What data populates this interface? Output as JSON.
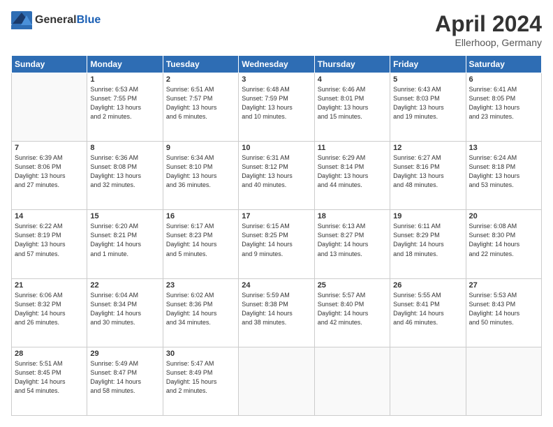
{
  "header": {
    "logo_general": "General",
    "logo_blue": "Blue",
    "month": "April 2024",
    "location": "Ellerhoop, Germany"
  },
  "weekdays": [
    "Sunday",
    "Monday",
    "Tuesday",
    "Wednesday",
    "Thursday",
    "Friday",
    "Saturday"
  ],
  "weeks": [
    [
      {
        "day": "",
        "info": ""
      },
      {
        "day": "1",
        "info": "Sunrise: 6:53 AM\nSunset: 7:55 PM\nDaylight: 13 hours\nand 2 minutes."
      },
      {
        "day": "2",
        "info": "Sunrise: 6:51 AM\nSunset: 7:57 PM\nDaylight: 13 hours\nand 6 minutes."
      },
      {
        "day": "3",
        "info": "Sunrise: 6:48 AM\nSunset: 7:59 PM\nDaylight: 13 hours\nand 10 minutes."
      },
      {
        "day": "4",
        "info": "Sunrise: 6:46 AM\nSunset: 8:01 PM\nDaylight: 13 hours\nand 15 minutes."
      },
      {
        "day": "5",
        "info": "Sunrise: 6:43 AM\nSunset: 8:03 PM\nDaylight: 13 hours\nand 19 minutes."
      },
      {
        "day": "6",
        "info": "Sunrise: 6:41 AM\nSunset: 8:05 PM\nDaylight: 13 hours\nand 23 minutes."
      }
    ],
    [
      {
        "day": "7",
        "info": "Sunrise: 6:39 AM\nSunset: 8:06 PM\nDaylight: 13 hours\nand 27 minutes."
      },
      {
        "day": "8",
        "info": "Sunrise: 6:36 AM\nSunset: 8:08 PM\nDaylight: 13 hours\nand 32 minutes."
      },
      {
        "day": "9",
        "info": "Sunrise: 6:34 AM\nSunset: 8:10 PM\nDaylight: 13 hours\nand 36 minutes."
      },
      {
        "day": "10",
        "info": "Sunrise: 6:31 AM\nSunset: 8:12 PM\nDaylight: 13 hours\nand 40 minutes."
      },
      {
        "day": "11",
        "info": "Sunrise: 6:29 AM\nSunset: 8:14 PM\nDaylight: 13 hours\nand 44 minutes."
      },
      {
        "day": "12",
        "info": "Sunrise: 6:27 AM\nSunset: 8:16 PM\nDaylight: 13 hours\nand 48 minutes."
      },
      {
        "day": "13",
        "info": "Sunrise: 6:24 AM\nSunset: 8:18 PM\nDaylight: 13 hours\nand 53 minutes."
      }
    ],
    [
      {
        "day": "14",
        "info": "Sunrise: 6:22 AM\nSunset: 8:19 PM\nDaylight: 13 hours\nand 57 minutes."
      },
      {
        "day": "15",
        "info": "Sunrise: 6:20 AM\nSunset: 8:21 PM\nDaylight: 14 hours\nand 1 minute."
      },
      {
        "day": "16",
        "info": "Sunrise: 6:17 AM\nSunset: 8:23 PM\nDaylight: 14 hours\nand 5 minutes."
      },
      {
        "day": "17",
        "info": "Sunrise: 6:15 AM\nSunset: 8:25 PM\nDaylight: 14 hours\nand 9 minutes."
      },
      {
        "day": "18",
        "info": "Sunrise: 6:13 AM\nSunset: 8:27 PM\nDaylight: 14 hours\nand 13 minutes."
      },
      {
        "day": "19",
        "info": "Sunrise: 6:11 AM\nSunset: 8:29 PM\nDaylight: 14 hours\nand 18 minutes."
      },
      {
        "day": "20",
        "info": "Sunrise: 6:08 AM\nSunset: 8:30 PM\nDaylight: 14 hours\nand 22 minutes."
      }
    ],
    [
      {
        "day": "21",
        "info": "Sunrise: 6:06 AM\nSunset: 8:32 PM\nDaylight: 14 hours\nand 26 minutes."
      },
      {
        "day": "22",
        "info": "Sunrise: 6:04 AM\nSunset: 8:34 PM\nDaylight: 14 hours\nand 30 minutes."
      },
      {
        "day": "23",
        "info": "Sunrise: 6:02 AM\nSunset: 8:36 PM\nDaylight: 14 hours\nand 34 minutes."
      },
      {
        "day": "24",
        "info": "Sunrise: 5:59 AM\nSunset: 8:38 PM\nDaylight: 14 hours\nand 38 minutes."
      },
      {
        "day": "25",
        "info": "Sunrise: 5:57 AM\nSunset: 8:40 PM\nDaylight: 14 hours\nand 42 minutes."
      },
      {
        "day": "26",
        "info": "Sunrise: 5:55 AM\nSunset: 8:41 PM\nDaylight: 14 hours\nand 46 minutes."
      },
      {
        "day": "27",
        "info": "Sunrise: 5:53 AM\nSunset: 8:43 PM\nDaylight: 14 hours\nand 50 minutes."
      }
    ],
    [
      {
        "day": "28",
        "info": "Sunrise: 5:51 AM\nSunset: 8:45 PM\nDaylight: 14 hours\nand 54 minutes."
      },
      {
        "day": "29",
        "info": "Sunrise: 5:49 AM\nSunset: 8:47 PM\nDaylight: 14 hours\nand 58 minutes."
      },
      {
        "day": "30",
        "info": "Sunrise: 5:47 AM\nSunset: 8:49 PM\nDaylight: 15 hours\nand 2 minutes."
      },
      {
        "day": "",
        "info": ""
      },
      {
        "day": "",
        "info": ""
      },
      {
        "day": "",
        "info": ""
      },
      {
        "day": "",
        "info": ""
      }
    ]
  ]
}
